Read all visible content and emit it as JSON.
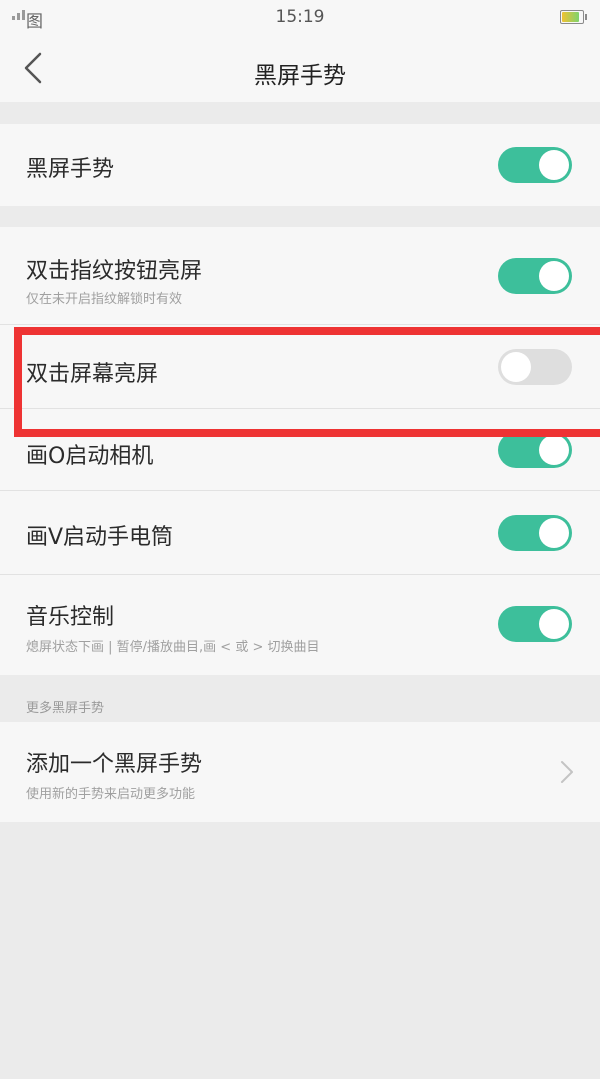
{
  "status_bar": {
    "carrier": "图",
    "time": "15:19",
    "battery_level": 0.85
  },
  "header": {
    "title": "黑屏手势",
    "back_icon": "chevron-left-icon"
  },
  "main_toggle": {
    "label": "黑屏手势",
    "enabled": true
  },
  "gestures": [
    {
      "label": "双击指纹按钮亮屏",
      "sub": "仅在未开启指纹解锁时有效",
      "enabled": true
    },
    {
      "label": "双击屏幕亮屏",
      "sub": "",
      "enabled": false
    },
    {
      "label": "画O启动相机",
      "sub": "",
      "enabled": true
    },
    {
      "label": "画V启动手电筒",
      "sub": "",
      "enabled": true
    },
    {
      "label": "音乐控制",
      "sub": "熄屏状态下画 | 暂停/播放曲目,画 < 或 > 切换曲目",
      "enabled": true
    }
  ],
  "more_section": {
    "label": "更多黑屏手势",
    "add_item": {
      "label": "添加一个黑屏手势",
      "sub": "使用新的手势来启动更多功能",
      "icon": "chevron-right-icon"
    }
  },
  "colors": {
    "toggle_on": "#3dbf9b",
    "toggle_off": "#dedede",
    "highlight": "#ee3333"
  }
}
